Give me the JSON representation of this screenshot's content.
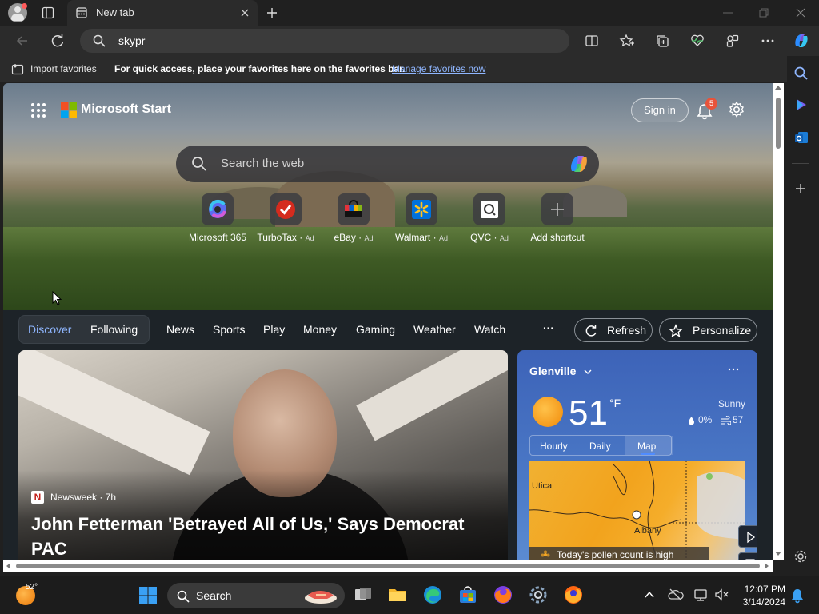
{
  "tab": {
    "title": "New tab"
  },
  "address": {
    "value": "skypr"
  },
  "favorites_bar": {
    "import_label": "Import favorites",
    "hint": "For quick access, place your favorites here on the favorites bar.",
    "manage_link": "Manage favorites now"
  },
  "header": {
    "brand": "Microsoft Start",
    "signin": "Sign in",
    "notification_count": "5"
  },
  "search": {
    "placeholder": "Search the web"
  },
  "shortcuts": [
    {
      "label": "Microsoft 365",
      "ad": ""
    },
    {
      "label": "TurboTax",
      "ad": "Ad"
    },
    {
      "label": "eBay",
      "ad": "Ad"
    },
    {
      "label": "Walmart",
      "ad": "Ad"
    },
    {
      "label": "QVC",
      "ad": "Ad"
    },
    {
      "label": "Add shortcut",
      "ad": ""
    }
  ],
  "nav": {
    "discover": "Discover",
    "following": "Following",
    "items": [
      "News",
      "Sports",
      "Play",
      "Money",
      "Gaming",
      "Weather",
      "Watch"
    ],
    "more": "···",
    "refresh": "Refresh",
    "personalize": "Personalize"
  },
  "news": {
    "source": "Newsweek · 7h",
    "source_logo": "N",
    "headline": "John Fetterman 'Betrayed All of Us,' Says Democrat PAC"
  },
  "weather": {
    "location": "Glenville",
    "temp": "51",
    "unit": "°F",
    "condition": "Sunny",
    "precip": "0%",
    "wind": "57",
    "tabs": [
      "Hourly",
      "Daily",
      "Map"
    ],
    "selected_tab": "Map",
    "map_labels": [
      "Utica",
      "Albany"
    ],
    "pollen": "Today's pollen count is high"
  },
  "taskbar": {
    "weather_temp": "52°",
    "search": "Search",
    "time": "12:07 PM",
    "date": "3/14/2024"
  },
  "colors": {
    "accent": "#4f8cff",
    "link": "#8fb6ff",
    "badge": "#e8533a"
  }
}
